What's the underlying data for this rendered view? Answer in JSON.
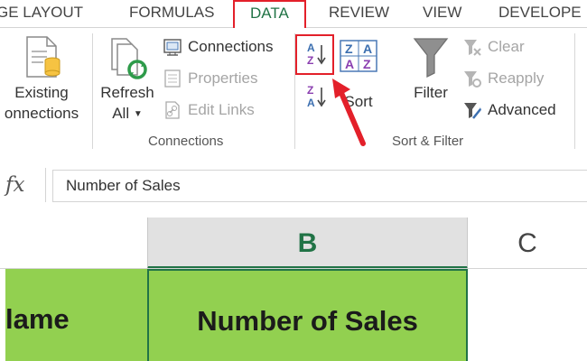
{
  "tabs": [
    {
      "label": "GE LAYOUT"
    },
    {
      "label": "FORMULAS"
    },
    {
      "label": "DATA",
      "active": true
    },
    {
      "label": "REVIEW"
    },
    {
      "label": "VIEW"
    },
    {
      "label": "DEVELOPE"
    }
  ],
  "ribbon": {
    "get_external": {
      "existing_line1": "Existing",
      "existing_line2": "onnections"
    },
    "connections_group": {
      "label": "Connections",
      "refresh_line1": "Refresh",
      "refresh_line2": "All",
      "connections": "Connections",
      "properties": "Properties",
      "edit_links": "Edit Links"
    },
    "sort_filter_group": {
      "label": "Sort & Filter",
      "sort": "Sort",
      "filter": "Filter",
      "clear": "Clear",
      "reapply": "Reapply",
      "advanced": "Advanced"
    }
  },
  "formula_bar": {
    "fx": "fx",
    "value": "Number of Sales"
  },
  "grid": {
    "columns": [
      "B",
      "C"
    ],
    "cells": {
      "a1": "lame",
      "b1": "Number of Sales"
    }
  },
  "colors": {
    "accent_green": "#217346",
    "highlight_red": "#e3202a",
    "cell_fill": "#92d050"
  }
}
